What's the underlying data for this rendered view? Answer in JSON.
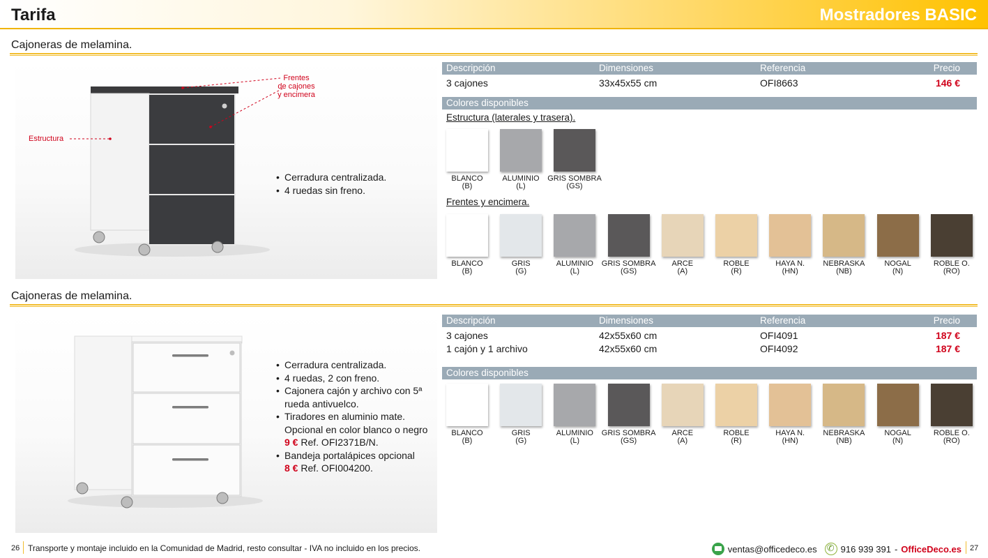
{
  "header": {
    "left_title": "Tarifa",
    "right_title": "Mostradores BASIC"
  },
  "section1": {
    "title": "Cajoneras de melamina.",
    "callouts": {
      "frentes": "Frentes\nde cajones\ny encimera",
      "estructura": "Estructura"
    },
    "features": [
      "Cerradura centralizada.",
      "4 ruedas sin freno."
    ],
    "table": {
      "headers": [
        "Descripción",
        "Dimensiones",
        "Referencia",
        "Precio"
      ],
      "rows": [
        {
          "desc": "3 cajones",
          "dim": "33x45x55 cm",
          "ref": "OFI8663",
          "price": "146 €"
        }
      ]
    },
    "colors_header": "Colores disponibles",
    "structure_label": "Estructura (laterales y trasera).",
    "structure_swatches": [
      {
        "name": "BLANCO",
        "code": "(B)",
        "color": "#ffffff"
      },
      {
        "name": "ALUMINIO",
        "code": "(L)",
        "color": "#a7a8ab"
      },
      {
        "name": "GRIS SOMBRA",
        "code": "(GS)",
        "color": "#5a5859"
      }
    ],
    "front_label": "Frentes y encimera.",
    "front_swatches": [
      {
        "name": "BLANCO",
        "code": "(B)",
        "color": "#ffffff"
      },
      {
        "name": "GRIS",
        "code": "(G)",
        "color": "#e3e7ea"
      },
      {
        "name": "ALUMINIO",
        "code": "(L)",
        "color": "#a7a8ab"
      },
      {
        "name": "GRIS SOMBRA",
        "code": "(GS)",
        "color": "#5a5859"
      },
      {
        "name": "ARCE",
        "code": "(A)",
        "color": "#e7d5b8"
      },
      {
        "name": "ROBLE",
        "code": "(R)",
        "color": "#ecd1a6"
      },
      {
        "name": "HAYA N.",
        "code": "(HN)",
        "color": "#e3c196"
      },
      {
        "name": "NEBRASKA",
        "code": "(NB)",
        "color": "#d6b887"
      },
      {
        "name": "NOGAL",
        "code": "(N)",
        "color": "#8c6d48"
      },
      {
        "name": "ROBLE O.",
        "code": "(RO)",
        "color": "#4a3f33"
      }
    ]
  },
  "section2": {
    "title": "Cajoneras de melamina.",
    "features": [
      {
        "text": "Cerradura centralizada."
      },
      {
        "text": "4 ruedas, 2 con freno."
      },
      {
        "text": "Cajonera cajón y archivo con 5ª rueda antivuelco."
      },
      {
        "text": "Tiradores en aluminio mate. Opcional en color blanco o negro",
        "price": "9 €",
        "ref": "Ref. OFI2371B/N."
      },
      {
        "text": "Bandeja portalápices opcional",
        "price": "8 €",
        "ref": "Ref. OFI004200."
      }
    ],
    "table": {
      "headers": [
        "Descripción",
        "Dimensiones",
        "Referencia",
        "Precio"
      ],
      "rows": [
        {
          "desc": "3 cajones",
          "dim": "42x55x60 cm",
          "ref": "OFI4091",
          "price": "187 €"
        },
        {
          "desc": "1 cajón y 1 archivo",
          "dim": "42x55x60 cm",
          "ref": "OFI4092",
          "price": "187 €"
        }
      ]
    },
    "colors_header": "Colores disponibles",
    "swatches": [
      {
        "name": "BLANCO",
        "code": "(B)",
        "color": "#ffffff"
      },
      {
        "name": "GRIS",
        "code": "(G)",
        "color": "#e3e7ea"
      },
      {
        "name": "ALUMINIO",
        "code": "(L)",
        "color": "#a7a8ab"
      },
      {
        "name": "GRIS SOMBRA",
        "code": "(GS)",
        "color": "#5a5859"
      },
      {
        "name": "ARCE",
        "code": "(A)",
        "color": "#e7d5b8"
      },
      {
        "name": "ROBLE",
        "code": "(R)",
        "color": "#ecd1a6"
      },
      {
        "name": "HAYA N.",
        "code": "(HN)",
        "color": "#e3c196"
      },
      {
        "name": "NEBRASKA",
        "code": "(NB)",
        "color": "#d6b887"
      },
      {
        "name": "NOGAL",
        "code": "(N)",
        "color": "#8c6d48"
      },
      {
        "name": "ROBLE O.",
        "code": "(RO)",
        "color": "#4a3f33"
      }
    ]
  },
  "footer": {
    "page_left": "26",
    "note": "Transporte y montaje incluido en la Comunidad de Madrid, resto consultar - IVA no incluido en los precios.",
    "email": "ventas@officedeco.es",
    "phone": "916 939 391",
    "dash": "-",
    "brand": "OfficeDeco.es",
    "page_right": "27"
  }
}
